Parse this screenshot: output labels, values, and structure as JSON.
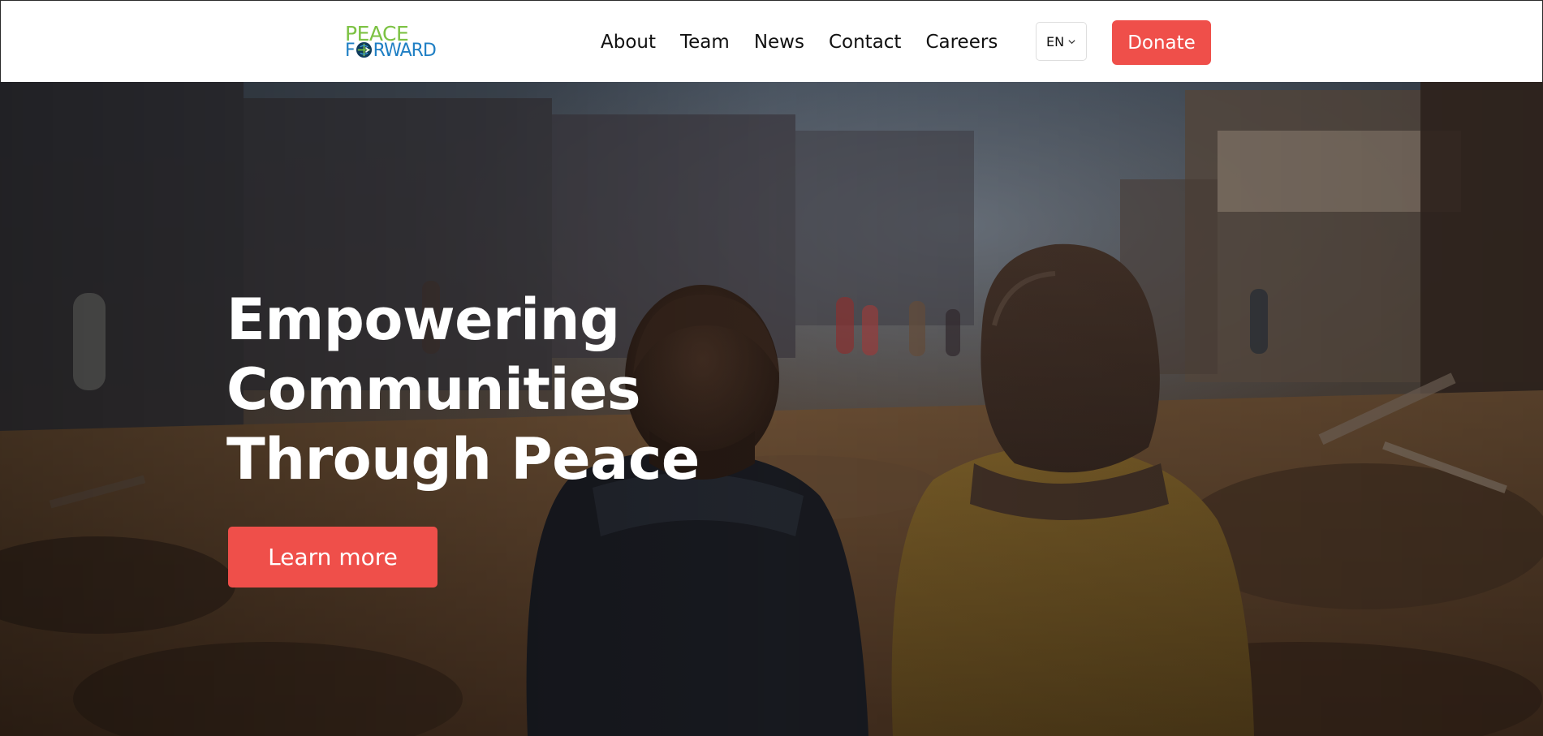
{
  "header": {
    "logo": {
      "line1": "PEACE",
      "line2_prefix": "F",
      "line2_suffix": "RWARD",
      "icon": "globe-icon",
      "colors": {
        "green": "#7cc243",
        "blue": "#1f7fc4"
      }
    },
    "nav": [
      {
        "label": "About"
      },
      {
        "label": "Team"
      },
      {
        "label": "News"
      },
      {
        "label": "Contact"
      },
      {
        "label": "Careers"
      }
    ],
    "language": {
      "selected": "EN",
      "icon": "chevron-down-icon"
    },
    "donate_label": "Donate"
  },
  "hero": {
    "title_lines": [
      "Empowering",
      "Communities",
      "Through Peace"
    ],
    "cta_label": "Learn more",
    "background": "photo-two-people-sitting-facing-ruined-street"
  },
  "colors": {
    "accent": "#ef4f4a",
    "text_dark": "#111111",
    "header_bg": "#ffffff",
    "hero_text": "#ffffff"
  }
}
